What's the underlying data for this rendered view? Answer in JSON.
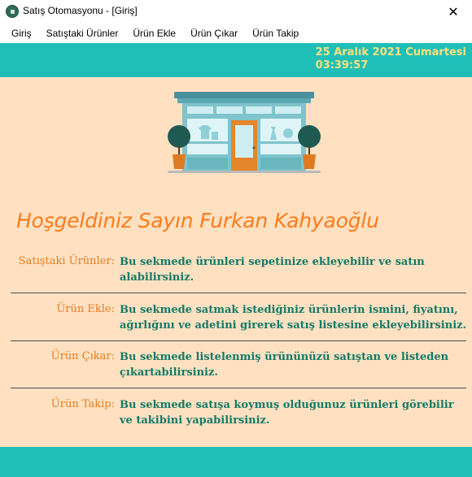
{
  "window": {
    "title": "Satış Otomasyonu - [Giriş]",
    "close_glyph": "✕",
    "app_icon": "store-app-icon"
  },
  "menu": {
    "items": [
      "Giriş",
      "Satıştaki Ürünler",
      "Ürün Ekle",
      "Ürün Çıkar",
      "Ürün Takip"
    ]
  },
  "header": {
    "date": "25 Aralık 2021 Cumartesi",
    "time": "03:39:57"
  },
  "main": {
    "welcome": "Hoşgeldiniz Sayın Furkan Kahyaoğlu",
    "sections": [
      {
        "label": "Satıştaki Ürünler:",
        "description": "Bu sekmede ürünleri sepetinize ekleyebilir ve satın alabilirsiniz."
      },
      {
        "label": "Ürün Ekle:",
        "description": "Bu sekmede satmak istediğiniz ürünlerin ismini, fiyatını, ağırlığını ve adetini girerek satış listesine ekleyebilirsiniz."
      },
      {
        "label": "Ürün Çıkar:",
        "description": "Bu sekmede listelenmiş ürününüzü satıştan ve listeden çıkartabilirsiniz."
      },
      {
        "label": "Ürün Takip:",
        "description": "Bu sekmede satışa koymuş olduğunuz ürünleri görebilir ve takibini yapabilirsiniz."
      }
    ]
  },
  "colors": {
    "teal_band": "#1fbfb8",
    "content_bg": "#ffe1c2",
    "accent_orange": "#ff7b1a",
    "desc_green": "#137a66",
    "datetime_yellow": "#ffe07a"
  }
}
